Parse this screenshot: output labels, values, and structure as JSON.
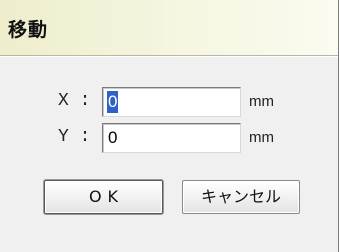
{
  "dialog": {
    "title": "移動",
    "x_label": "X :",
    "x_value": "0",
    "x_unit": "mm",
    "y_label": "Y :",
    "y_value": "0",
    "y_unit": "mm",
    "ok_label": "OK",
    "cancel_label": "キャンセル"
  },
  "colors": {
    "title_bg": "#eeeecc",
    "selection": "#2f62c9",
    "body_bg": "#f0f0f0"
  }
}
